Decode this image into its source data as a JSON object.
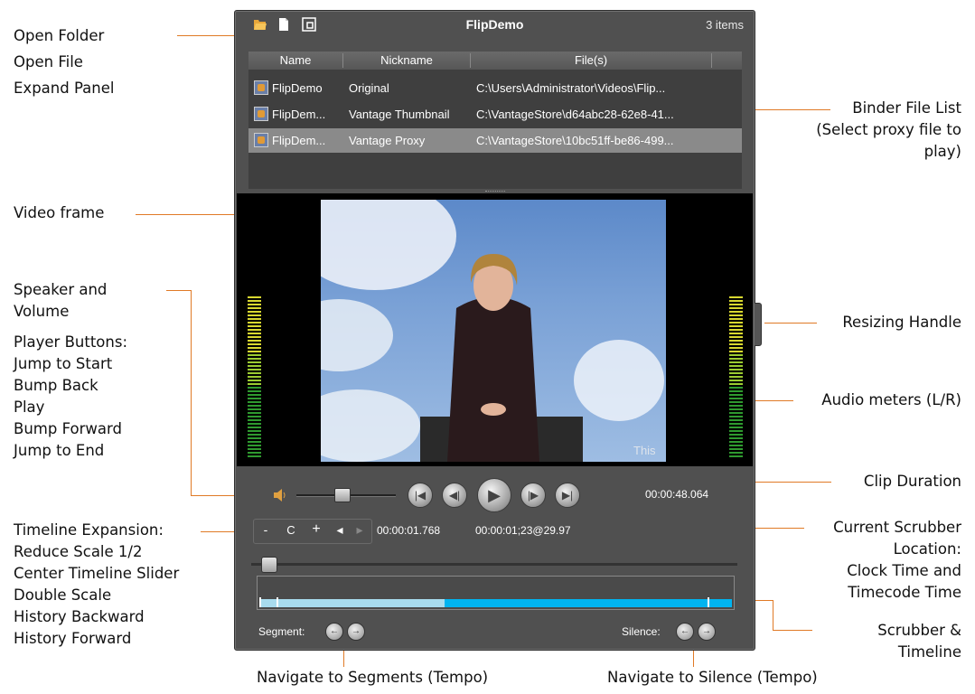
{
  "callouts": {
    "open_folder": "Open Folder",
    "open_file": "Open File",
    "expand_panel": "Expand Panel",
    "video_frame": "Video frame",
    "speaker_volume": "Speaker and\nVolume",
    "player_buttons": "Player Buttons:\nJump to Start\nBump Back\nPlay\nBump Forward\nJump to End",
    "timeline_expansion": "Timeline Expansion:\nReduce Scale 1/2\nCenter Timeline Slider\nDouble Scale\nHistory Backward\nHistory Forward",
    "binder_file_list": "Binder File List\n(Select proxy file to\nplay)",
    "resizing_handle": "Resizing Handle",
    "audio_meters": "Audio meters (L/R)",
    "clip_duration": "Clip Duration",
    "current_scrubber": "Current Scrubber\nLocation:\nClock Time and\nTimecode Time",
    "scrubber_timeline": "Scrubber &\nTimeline",
    "navigate_segments": "Navigate to Segments (Tempo)",
    "navigate_silence": "Navigate to Silence (Tempo)"
  },
  "app": {
    "title": "FlipDemo",
    "items_count": "3 items",
    "toolbar_icons": [
      "folder-open-icon",
      "file-icon",
      "expand-panel-icon"
    ],
    "columns": [
      "Name",
      "Nickname",
      "File(s)"
    ],
    "rows": [
      {
        "name": "FlipDemo",
        "nickname": "Original",
        "file": "C:\\Users\\Administrator\\Videos\\Flip...",
        "selected": false
      },
      {
        "name": "FlipDem...",
        "nickname": "Vantage Thumbnail",
        "file": "C:\\VantageStore\\d64abc28-62e8-41...",
        "selected": false
      },
      {
        "name": "FlipDem...",
        "nickname": "Vantage Proxy",
        "file": "C:\\VantageStore\\10bc51ff-be86-499...",
        "selected": true
      }
    ],
    "video_watermark": "This",
    "clip_duration": "00:00:48.064",
    "clock_time": "00:00:01.768",
    "timecode": "00:00:01;23@29.97",
    "timeline_buttons": {
      "reduce": "-",
      "center": "C",
      "double": "+",
      "back": "◂",
      "forward": "▸"
    },
    "segment_label": "Segment:",
    "silence_label": "Silence:",
    "volume_level": 0.45,
    "scrub_position": 0.02,
    "accent_color": "#00b4f0",
    "played_color": "#a8dcee"
  }
}
